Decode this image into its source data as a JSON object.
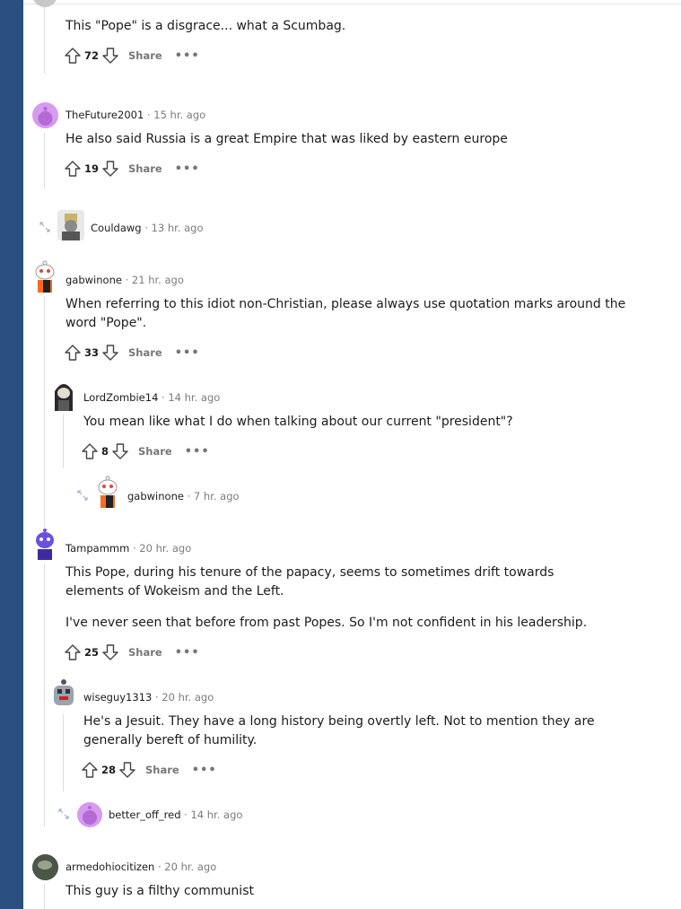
{
  "comments": [
    {
      "id": "c0",
      "author": "",
      "time": "",
      "text": "This \"Pope\" is a disgrace... what a Scumbag.",
      "votes": "72"
    },
    {
      "id": "c1",
      "author": "TheFuture2001",
      "time": "15 hr. ago",
      "text": "He also said Russia is a great Empire that was liked by eastern europe",
      "votes": "19"
    },
    {
      "id": "c2",
      "author": "Couldawg",
      "time": "13 hr. ago",
      "collapsed": true
    },
    {
      "id": "c3",
      "author": "gabwinone",
      "time": "21 hr. ago",
      "text": "When referring to this idiot non-Christian, please always use quotation marks around the word \"Pope\".",
      "votes": "33"
    },
    {
      "id": "c4",
      "author": "LordZombie14",
      "time": "14 hr. ago",
      "text": "You mean like what I do when talking about our current \"president\"?",
      "votes": "8"
    },
    {
      "id": "c5",
      "author": "gabwinone",
      "time": "7 hr. ago",
      "collapsed": true
    },
    {
      "id": "c6",
      "author": "Tampammm",
      "time": "20 hr. ago",
      "text1": "This Pope, during his tenure of the papacy, seems to sometimes drift towards elements of Wokeism and the Left.",
      "text2": "I've never seen that before from past Popes. So I'm not confident in his leadership.",
      "votes": "25"
    },
    {
      "id": "c7",
      "author": "wiseguy1313",
      "time": "20 hr. ago",
      "text": "He's a Jesuit. They have a long history being overtly left. Not to mention they are generally bereft of humility.",
      "votes": "28"
    },
    {
      "id": "c8",
      "author": "better_off_red",
      "time": "14 hr. ago",
      "collapsed": true
    },
    {
      "id": "c9",
      "author": "armedohiocitizen",
      "time": "20 hr. ago",
      "text": "This guy is a filthy communist"
    }
  ],
  "labels": {
    "share": "Share",
    "dot": "·"
  },
  "colors": {
    "sidebar": "#2b4f81",
    "thread_line": "#dcdcdc"
  }
}
